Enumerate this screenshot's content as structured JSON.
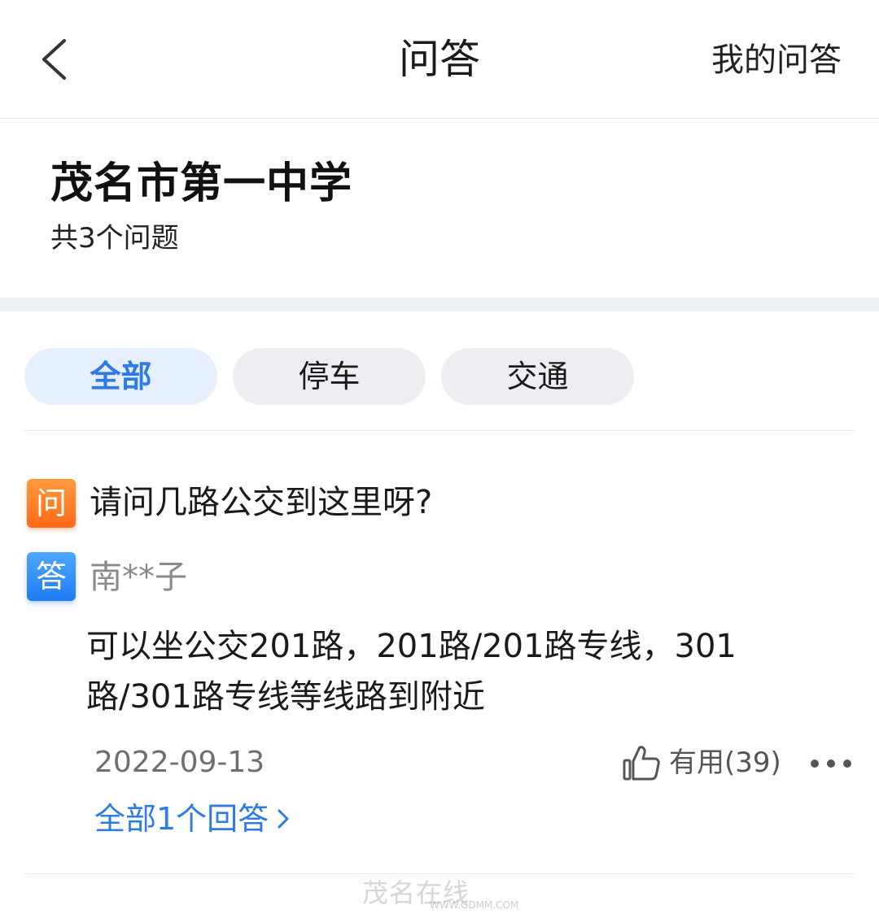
{
  "header": {
    "title": "问答",
    "my_questions": "我的问答"
  },
  "summary": {
    "place_name": "茂名市第一中学",
    "question_count": "共3个问题"
  },
  "tabs": [
    {
      "label": "全部",
      "active": true
    },
    {
      "label": "停车",
      "active": false
    },
    {
      "label": "交通",
      "active": false
    }
  ],
  "qa_items": [
    {
      "question_badge": "问",
      "question": "请问几路公交到这里呀?",
      "answer_badge": "答",
      "answerer": "南**子",
      "answer": "可以坐公交201路，201路/201路专线，301路/301路专线等线路到附近",
      "date": "2022-09-13",
      "useful_label": "有用(39)",
      "all_answers_label": "全部1个回答"
    }
  ],
  "watermark": {
    "text": "茂名在线",
    "url": "WWW.GDMM.COM"
  },
  "colors": {
    "accent_blue": "#2f7be5",
    "question_badge": "#ff7a22",
    "answer_badge": "#2a86f5",
    "tab_bg": "#eceef2",
    "tab_active_bg": "#e6effd"
  },
  "icons": [
    "back-arrow-icon",
    "thumbs-up-icon",
    "more-dots-icon",
    "chevron-right-icon"
  ]
}
